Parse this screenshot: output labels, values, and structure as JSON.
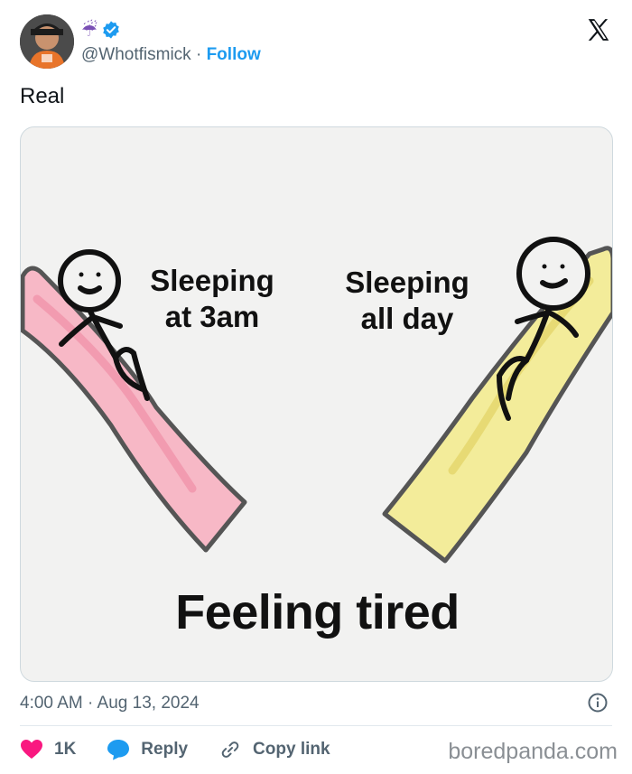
{
  "author": {
    "emoji": "☔",
    "handle": "@Whotfismick",
    "separator": "·",
    "follow_label": "Follow",
    "verified": true
  },
  "icons": {
    "close": "x-logo-icon",
    "verified": "verified-badge-icon",
    "info": "info-icon",
    "like": "heart-icon",
    "reply": "speech-bubble-icon",
    "copy_link": "link-icon"
  },
  "tweet": {
    "text": "Real",
    "timestamp": "4:00 AM · Aug 13, 2024"
  },
  "meme": {
    "left_label": "Sleeping at 3am",
    "right_label": "Sleeping all day",
    "caption": "Feeling tired"
  },
  "actions": {
    "like_count": "1K",
    "reply_label": "Reply",
    "copy_link_label": "Copy link"
  },
  "watermark": "boredpanda.com",
  "colors": {
    "follow": "#1d9bf0",
    "like": "#f91880",
    "reply": "#1d9bf0",
    "slide_left": "#f7b8c6",
    "slide_right": "#f3ec9a"
  }
}
